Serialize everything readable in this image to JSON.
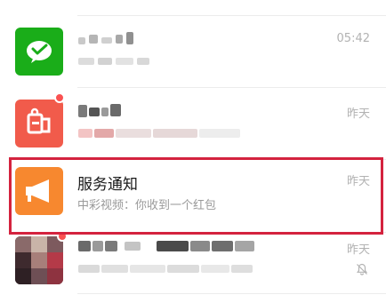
{
  "chats": [
    {
      "title": "",
      "subtitle": "",
      "time": "05:42",
      "avatar_icon": "wechat-pay-icon",
      "avatar_color": "#1aad19"
    },
    {
      "title": "",
      "subtitle": "",
      "time": "昨天",
      "avatar_icon": "shopping-bag-icon",
      "avatar_color": "#f15b4b",
      "unread_dot": true
    },
    {
      "title": "服务通知",
      "subtitle": "中彩视频：你收到一个红包",
      "time": "昨天",
      "avatar_icon": "megaphone-icon",
      "avatar_color": "#f7882f"
    },
    {
      "title": "",
      "subtitle": "",
      "time": "昨天",
      "avatar_icon": "photo-avatar",
      "unread_dot": true,
      "muted": true
    }
  ],
  "colors": {
    "highlight": "#d4233e",
    "unread": "#fa5151"
  }
}
